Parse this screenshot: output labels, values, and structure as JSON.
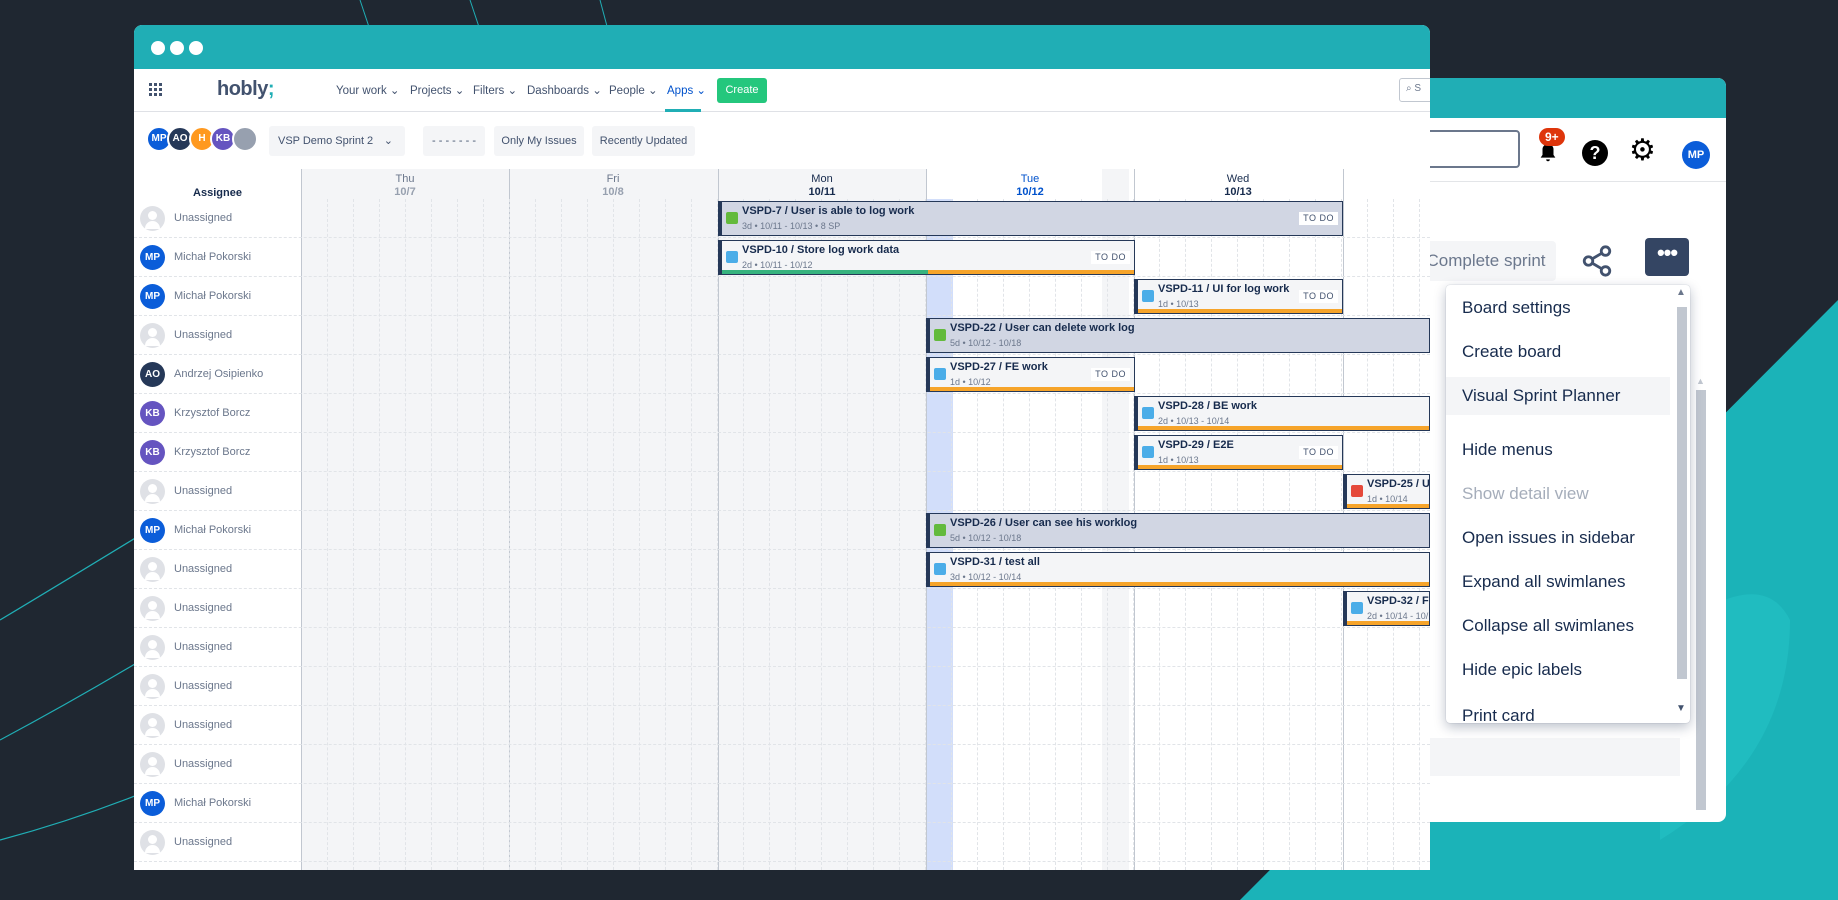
{
  "colors": {
    "teal": "#20aeb5",
    "dark": "#1f2731",
    "create": "#24c77d",
    "story": "#63ba3c",
    "task": "#4bade8",
    "bug": "#e5493a",
    "bar": "#f6a42a"
  },
  "nav": {
    "logo": "hobly",
    "logo_mark": ";",
    "items": [
      "Your work",
      "Projects",
      "Filters",
      "Dashboards",
      "People",
      "Apps"
    ],
    "active": "Apps",
    "create": "Create",
    "search_placeholder": "S"
  },
  "toolbar": {
    "avatars": [
      {
        "initials": "MP",
        "color": "#0b5dd9"
      },
      {
        "initials": "AO",
        "color": "#253858"
      },
      {
        "initials": "H",
        "color": "#ff991f"
      },
      {
        "initials": "KB",
        "color": "#6554c0"
      },
      {
        "initials": "",
        "color": "#97a0af"
      }
    ],
    "sprint": "VSP Demo Sprint 2",
    "dots": "- - - - - - -",
    "only_my": "Only My Issues",
    "recent": "Recently Updated"
  },
  "timeline": {
    "assignee_header": "Assignee",
    "days": [
      {
        "name": "Thu",
        "date": "10/7"
      },
      {
        "name": "Fri",
        "date": "10/8"
      },
      {
        "name": "Mon",
        "date": "10/11"
      },
      {
        "name": "Tue",
        "date": "10/12"
      },
      {
        "name": "Wed",
        "date": "10/13"
      }
    ],
    "rows": [
      {
        "name": "Unassigned",
        "initials": ""
      },
      {
        "name": "Michał Pokorski",
        "initials": "MP",
        "color": "#0b5dd9"
      },
      {
        "name": "Michał Pokorski",
        "initials": "MP",
        "color": "#0b5dd9"
      },
      {
        "name": "Unassigned",
        "initials": ""
      },
      {
        "name": "Andrzej Osipienko",
        "initials": "AO",
        "color": "#253858"
      },
      {
        "name": "Krzysztof Borcz",
        "initials": "KB",
        "color": "#6554c0"
      },
      {
        "name": "Krzysztof Borcz",
        "initials": "KB",
        "color": "#6554c0"
      },
      {
        "name": "Unassigned",
        "initials": ""
      },
      {
        "name": "Michał Pokorski",
        "initials": "MP",
        "color": "#0b5dd9"
      },
      {
        "name": "Unassigned",
        "initials": ""
      },
      {
        "name": "Unassigned",
        "initials": ""
      },
      {
        "name": "Unassigned",
        "initials": ""
      },
      {
        "name": "Unassigned",
        "initials": ""
      },
      {
        "name": "Unassigned",
        "initials": ""
      },
      {
        "name": "Unassigned",
        "initials": ""
      },
      {
        "name": "Michał Pokorski",
        "initials": "MP",
        "color": "#0b5dd9"
      },
      {
        "name": "Unassigned",
        "initials": ""
      }
    ],
    "cards": [
      {
        "title": "VSPD-7 / User is able to log work",
        "meta": "3d • 10/11 - 10/13 • 8 SP",
        "status": "TO DO",
        "type": "story"
      },
      {
        "title": "VSPD-10 / Store log work data",
        "meta": "2d • 10/11 - 10/12",
        "status": "TO DO",
        "type": "task",
        "progress": 0.5
      },
      {
        "title": "VSPD-11 / UI for log work",
        "meta": "1d • 10/13",
        "status": "TO DO",
        "type": "task"
      },
      {
        "title": "VSPD-22 / User can delete work log",
        "meta": "5d • 10/12 - 10/18",
        "status": "",
        "type": "story"
      },
      {
        "title": "VSPD-27 / FE work",
        "meta": "1d • 10/12",
        "status": "TO DO",
        "type": "task"
      },
      {
        "title": "VSPD-28 / BE work",
        "meta": "2d • 10/13 - 10/14",
        "status": "",
        "type": "task"
      },
      {
        "title": "VSPD-29 / E2E",
        "meta": "1d • 10/13",
        "status": "TO DO",
        "type": "task"
      },
      {
        "title": "VSPD-25 / U",
        "meta": "1d • 10/14",
        "status": "",
        "type": "bug"
      },
      {
        "title": "VSPD-26 / User can see his worklog",
        "meta": "5d • 10/12 - 10/18",
        "status": "",
        "type": "story"
      },
      {
        "title": "VSPD-31 / test all",
        "meta": "3d • 10/12 - 10/14",
        "status": "",
        "type": "task"
      },
      {
        "title": "VSPD-32 / F",
        "meta": "2d • 10/14 - 10/",
        "status": "",
        "type": "task"
      }
    ]
  },
  "board": {
    "notifications": "9+",
    "help": "?",
    "avatar": "MP",
    "complete_sprint": "Complete sprint",
    "more": "•••"
  },
  "menu": {
    "items": [
      "Board settings",
      "Create board",
      "Visual Sprint Planner",
      "Hide menus",
      "Show detail view",
      "Open issues in sidebar",
      "Expand all swimlanes",
      "Collapse all swimlanes",
      "Hide epic labels",
      "Print card"
    ],
    "active": "Visual Sprint Planner",
    "disabled": "Show detail view"
  }
}
